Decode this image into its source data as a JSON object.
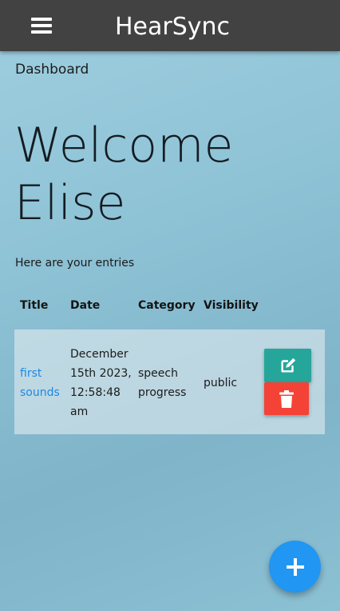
{
  "navbar": {
    "title": "HearSync",
    "menu_icon": "hamburger-icon"
  },
  "breadcrumb": "Dashboard",
  "welcome": {
    "line1": "Welcome",
    "line2": "Elise"
  },
  "intro": "Here are your entries",
  "table": {
    "headers": [
      "Title",
      "Date",
      "Category",
      "Visibility"
    ],
    "rows": [
      {
        "title": "first sounds",
        "date": "December 15th 2023, 12:58:48 am",
        "category": "speech progress",
        "visibility": "public"
      }
    ]
  },
  "actions": {
    "edit_icon": "edit-icon",
    "delete_icon": "trash-icon",
    "add_icon": "plus-icon"
  },
  "colors": {
    "navbar": "#424242",
    "edit": "#26a69a",
    "delete": "#f44336",
    "fab": "#2196f3",
    "link": "#1e88e5"
  }
}
